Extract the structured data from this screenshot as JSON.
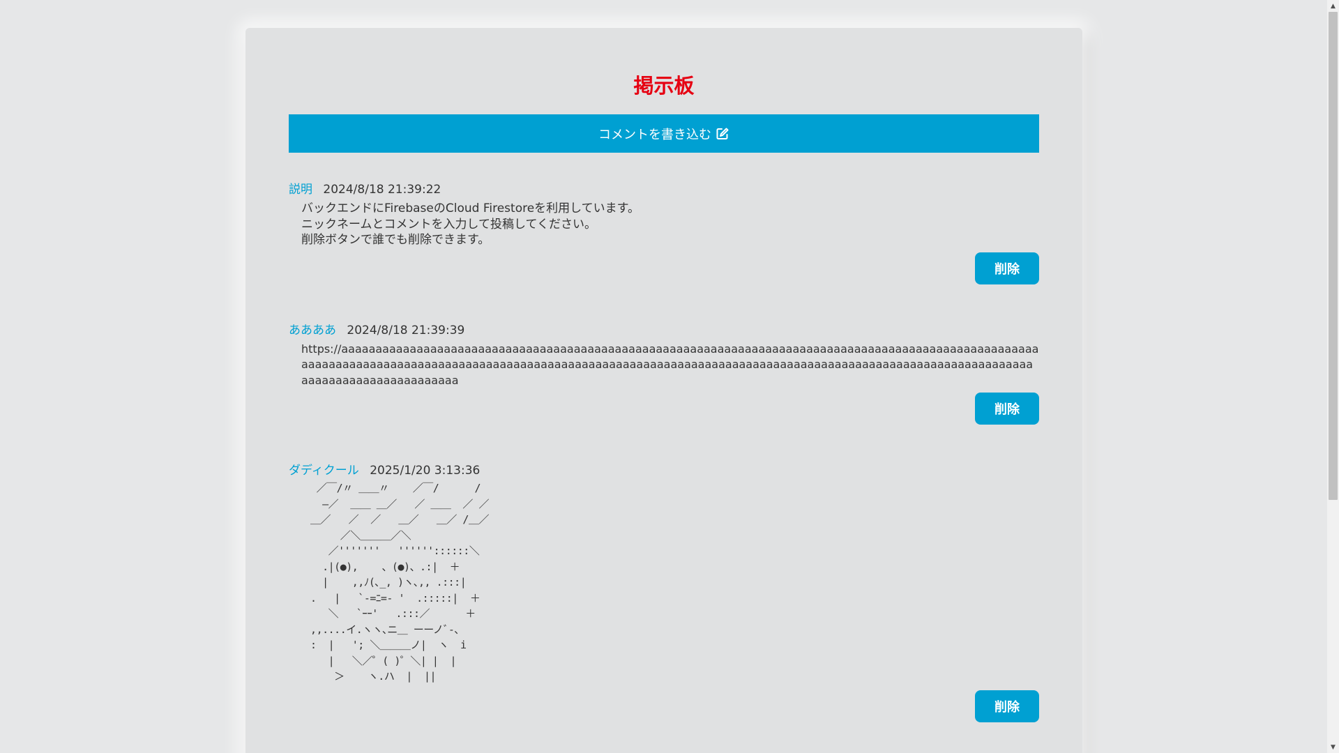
{
  "board": {
    "title": "掲示板",
    "write_button_label": "コメントを書き込む"
  },
  "icons": {
    "write": "edit-pencil-square-icon",
    "scroll_up": "triangle-up-icon",
    "scroll_down": "triangle-down-icon"
  },
  "colors": {
    "accent": "#00a0d2",
    "title": "#e60012",
    "background": "#e6e7e8",
    "panel": "#e0e1e2"
  },
  "posts": [
    {
      "name": "説明",
      "date": "2024/8/18 21:39:22",
      "body": "バックエンドにFirebaseのCloud Firestoreを利用しています。\nニックネームとコメントを入力して投稿してください。\n削除ボタンで誰でも削除できます。",
      "delete_label": "削除"
    },
    {
      "name": "ああああ",
      "date": "2024/8/18 21:39:39",
      "body": "https://aaaaaaaaaaaaaaaaaaaaaaaaaaaaaaaaaaaaaaaaaaaaaaaaaaaaaaaaaaaaaaaaaaaaaaaaaaaaaaaaaaaaaaaaaaaaaaaaaaaaaaaaaaaaaaaaaaaaaaaaaaaaaaaaaaaaaaaaaaaaaaaaaaaaaaaaaaaaaaaaaaaaaaaaaaaaaaaaaaaaaaaaaaaaaaaaaaaaaaaaaaaaaaaaaaaaaaaaaaaaaaaaaaaaaaaa",
      "delete_label": "削除"
    },
    {
      "name": "ダディクール",
      "date": "2025/1/20 3:13:36",
      "body": "   ／￣/〃 ＿＿〃    ／￣/      /\n    ―／  ＿＿ ＿／   ／ ＿＿  ／ ／\n  ＿／   ／  ／   ＿／   ＿／ /＿／\n       ／＼＿＿＿／＼\n     ／'''''''   ''''''::::::＼\n    .|(●),    、(●)、.:|  ＋\n    |    ,,ﾉ(､_, )ヽ､,, .:::|\n  .   |   `-=ﾆ=- '  .:::::|  ＋\n     ＼   `ｰｰ'   .:::／      ＋\n  ,,....イ.ヽヽ､ニ＿ ーーノﾞ-､\n  :  |   '; ＼＿＿＿ノ|  ヽ  i\n     |   ＼／゜( )゜＼| |  |\n      ＞    ヽ.ハ  |  ||",
      "delete_label": "削除"
    }
  ]
}
